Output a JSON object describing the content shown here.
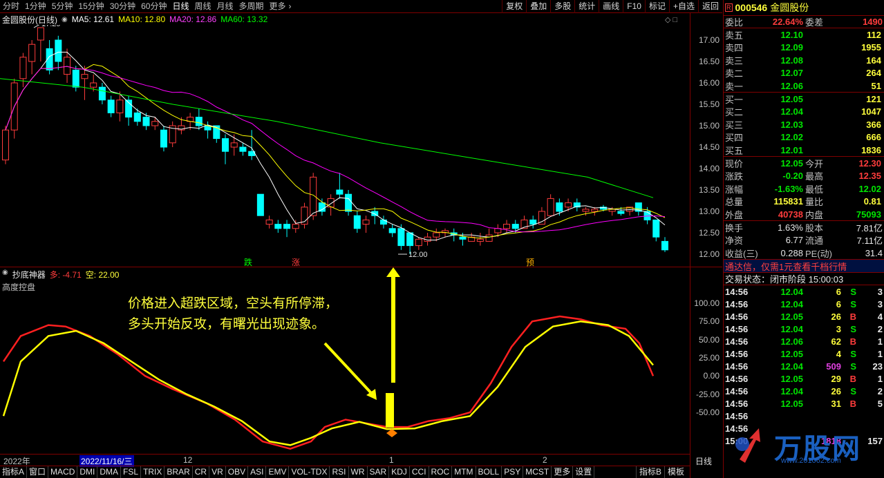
{
  "toolbar": {
    "periods": [
      "分时",
      "1分钟",
      "5分钟",
      "15分钟",
      "30分钟",
      "60分钟",
      "日线",
      "周线",
      "月线",
      "多周期",
      "更多"
    ],
    "active_period": "日线",
    "right_buttons": [
      "复权",
      "叠加",
      "多股",
      "统计",
      "画线",
      "F10",
      "标记",
      "+自选",
      "返回"
    ]
  },
  "main_chart": {
    "name": "金圆股份(日线)",
    "ma5": "MA5: 12.61",
    "ma10": "MA10: 12.80",
    "ma20": "MA20: 12.86",
    "ma60": "MA60: 13.32",
    "high_label": "17.29",
    "low_label": "12.00",
    "y_ticks": [
      "17.00",
      "16.50",
      "16.00",
      "15.50",
      "15.00",
      "14.50",
      "14.00",
      "13.50",
      "13.00",
      "12.50",
      "12.00"
    ],
    "markers": [
      "跌",
      "涨",
      "预"
    ],
    "colors": {
      "up": "#ff3c3c",
      "down": "#00ffff",
      "ma5": "#ffffff",
      "ma10": "#ffff00",
      "ma20": "#ff00ff",
      "ma60": "#00ff00"
    }
  },
  "indicator": {
    "name": "抄底神器",
    "duo": "多: -4.71",
    "kong": "空: 22.00",
    "sub": "高度控盘",
    "y_ticks": [
      "100.00",
      "75.00",
      "50.00",
      "25.00",
      "0.00",
      "-25.00",
      "-50.00"
    ],
    "annotation_line1": "价格进入超跌区域，空头有所停滞，",
    "annotation_line2": "多头开始反攻，有曙光出现迹象。"
  },
  "time_axis": {
    "labels": [
      "2022年",
      "2022/11/16/三",
      "12",
      "1",
      "2"
    ],
    "period": "日线"
  },
  "bottom_tabs": [
    "指标A",
    "窗口",
    "MACD",
    "DMI",
    "DMA",
    "FSL",
    "TRIX",
    "BRAR",
    "CR",
    "VR",
    "OBV",
    "ASI",
    "EMV",
    "VOL-TDX",
    "RSI",
    "WR",
    "SAR",
    "KDJ",
    "CCI",
    "ROC",
    "MTM",
    "BOLL",
    "PSY",
    "MCST",
    "更多",
    "设置"
  ],
  "bottom_right": [
    "指标B",
    "模板"
  ],
  "quote": {
    "code": "000546",
    "name": "金圆股份",
    "badge": "R",
    "weibi_label": "委比",
    "weibi": "22.64%",
    "weicha_label": "委差",
    "weicha": "1490",
    "sells": [
      {
        "label": "卖五",
        "price": "12.10",
        "vol": "112"
      },
      {
        "label": "卖四",
        "price": "12.09",
        "vol": "1955"
      },
      {
        "label": "卖三",
        "price": "12.08",
        "vol": "164"
      },
      {
        "label": "卖二",
        "price": "12.07",
        "vol": "264"
      },
      {
        "label": "卖一",
        "price": "12.06",
        "vol": "51"
      }
    ],
    "buys": [
      {
        "label": "买一",
        "price": "12.05",
        "vol": "121"
      },
      {
        "label": "买二",
        "price": "12.04",
        "vol": "1047"
      },
      {
        "label": "买三",
        "price": "12.03",
        "vol": "366"
      },
      {
        "label": "买四",
        "price": "12.02",
        "vol": "666"
      },
      {
        "label": "买五",
        "price": "12.01",
        "vol": "1836"
      }
    ],
    "stats": [
      {
        "l1": "现价",
        "v1": "12.05",
        "c1": "green",
        "l2": "今开",
        "v2": "12.30",
        "c2": "red"
      },
      {
        "l1": "涨跌",
        "v1": "-0.20",
        "c1": "green",
        "l2": "最高",
        "v2": "12.35",
        "c2": "red"
      },
      {
        "l1": "涨幅",
        "v1": "-1.63%",
        "c1": "green",
        "l2": "最低",
        "v2": "12.02",
        "c2": "green"
      },
      {
        "l1": "总量",
        "v1": "115831",
        "c1": "yellow",
        "l2": "量比",
        "v2": "0.81",
        "c2": "yellow"
      },
      {
        "l1": "外盘",
        "v1": "40738",
        "c1": "red",
        "l2": "内盘",
        "v2": "75093",
        "c2": "green"
      }
    ],
    "stats2": [
      {
        "l1": "换手",
        "v1": "1.63%",
        "l2": "股本",
        "v2": "7.81亿"
      },
      {
        "l1": "净资",
        "v1": "6.77",
        "l2": "流通",
        "v2": "7.11亿"
      },
      {
        "l1": "收益(三)",
        "v1": "0.288",
        "l2": "PE(动)",
        "v2": "31.4"
      }
    ],
    "promo": "通达信，仅需1元查看千档行情",
    "trade_state": "交易状态：闭市阶段 15:00:03",
    "ticks": [
      {
        "t": "14:56",
        "p": "12.04",
        "v": "6",
        "d": "S",
        "n": "3"
      },
      {
        "t": "14:56",
        "p": "12.04",
        "v": "6",
        "d": "S",
        "n": "3"
      },
      {
        "t": "14:56",
        "p": "12.05",
        "v": "26",
        "d": "B",
        "n": "4"
      },
      {
        "t": "14:56",
        "p": "12.04",
        "v": "3",
        "d": "S",
        "n": "2"
      },
      {
        "t": "14:56",
        "p": "12.06",
        "v": "62",
        "d": "B",
        "n": "1"
      },
      {
        "t": "14:56",
        "p": "12.05",
        "v": "4",
        "d": "S",
        "n": "1"
      },
      {
        "t": "14:56",
        "p": "12.04",
        "v": "509",
        "d": "S",
        "n": "23"
      },
      {
        "t": "14:56",
        "p": "12.05",
        "v": "29",
        "d": "B",
        "n": "1"
      },
      {
        "t": "14:56",
        "p": "12.04",
        "v": "26",
        "d": "S",
        "n": "2"
      },
      {
        "t": "14:56",
        "p": "12.05",
        "v": "31",
        "d": "B",
        "n": "5"
      },
      {
        "t": "14:56",
        "p": "",
        "v": "",
        "d": "",
        "n": ""
      },
      {
        "t": "14:56",
        "p": "",
        "v": "",
        "d": "",
        "n": ""
      },
      {
        "t": "15:00",
        "p": "",
        "v": "1818",
        "d": "",
        "n": "157"
      }
    ],
    "watermark": "万股网",
    "watermark_url": "www.201062.com"
  }
}
